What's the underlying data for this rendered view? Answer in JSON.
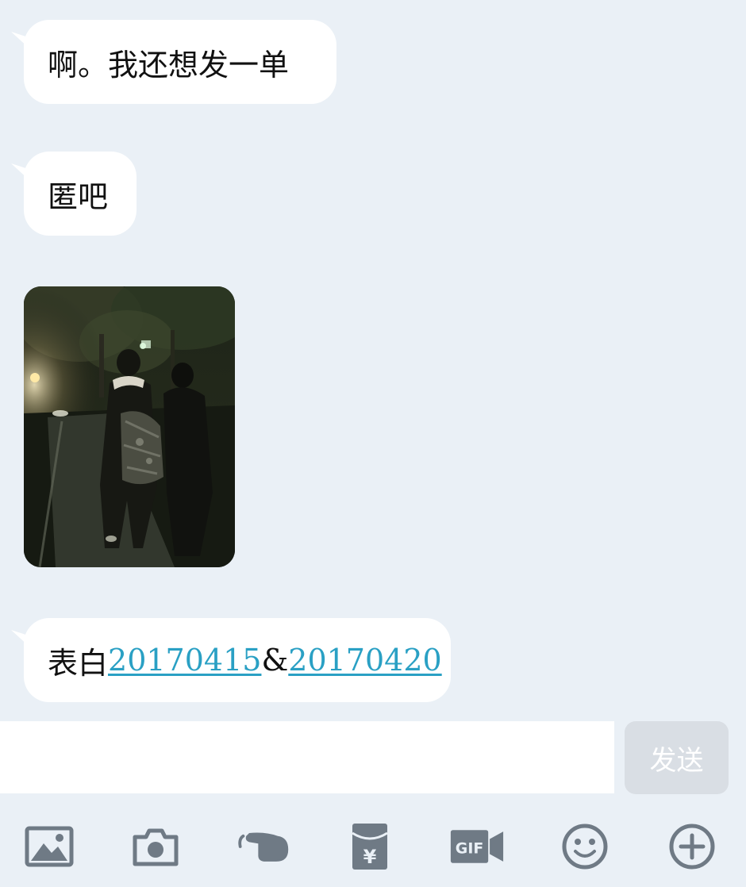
{
  "messages": [
    {
      "type": "text",
      "text": "啊。我还想发一单"
    },
    {
      "type": "text",
      "text": "匿吧"
    },
    {
      "type": "image"
    },
    {
      "type": "text",
      "prefix": "表白",
      "link1": "20170415",
      "sep": "&",
      "link2": "20170420"
    }
  ],
  "composer": {
    "input_value": "",
    "send_label": "发送"
  },
  "toolbar": {
    "icons": [
      "picture-icon",
      "camera-icon",
      "poke-hand-icon",
      "red-packet-icon",
      "gif-icon",
      "emoji-icon",
      "plus-icon"
    ]
  },
  "colors": {
    "background": "#eaf0f6",
    "bubble": "#ffffff",
    "link": "#2aa0c4",
    "send_button": "#d9dee4",
    "icon": "#6f7a85"
  }
}
